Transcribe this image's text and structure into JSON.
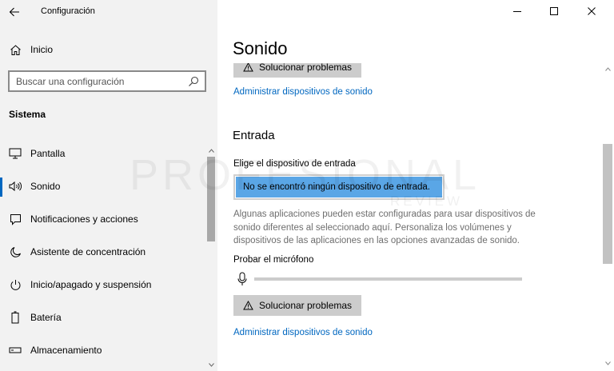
{
  "window": {
    "title": "Configuración",
    "controls": [
      "minimize",
      "maximize",
      "close"
    ]
  },
  "sidebar": {
    "home_label": "Inicio",
    "search_placeholder": "Buscar una configuración",
    "section_title": "Sistema",
    "items": [
      {
        "label": "Pantalla",
        "icon": "display-icon"
      },
      {
        "label": "Sonido",
        "icon": "speaker-icon",
        "selected": true
      },
      {
        "label": "Notificaciones y acciones",
        "icon": "notification-icon"
      },
      {
        "label": "Asistente de concentración",
        "icon": "moon-icon"
      },
      {
        "label": "Inicio/apagado y suspensión",
        "icon": "power-icon"
      },
      {
        "label": "Batería",
        "icon": "battery-icon"
      },
      {
        "label": "Almacenamiento",
        "icon": "storage-icon"
      }
    ]
  },
  "main": {
    "page_title": "Sonido",
    "output": {
      "troubleshoot_label": "Solucionar problemas",
      "manage_link": "Administrar dispositivos de sonido"
    },
    "input": {
      "heading": "Entrada",
      "device_label": "Elige el dispositivo de entrada",
      "device_value": "No se encontró ningún dispositivo de entrada.",
      "info_text": "Algunas aplicaciones pueden estar configuradas para usar dispositivos de sonido diferentes al seleccionado aquí. Personaliza los volúmenes y dispositivos de las aplicaciones en las opciones avanzadas de sonido.",
      "test_mic_label": "Probar el micrófono",
      "mic_level": 0,
      "troubleshoot_label": "Solucionar problemas",
      "manage_link": "Administrar dispositivos de sonido"
    }
  },
  "watermark": {
    "text": "PROFESIONAL",
    "subtext": "REVIEW"
  },
  "colors": {
    "accent": "#0067c0",
    "sidebar_bg": "#f2f2f2",
    "selected_device_bg": "#5aa6e6",
    "button_bg": "#cccccc",
    "info_text": "#6e6e6e"
  }
}
